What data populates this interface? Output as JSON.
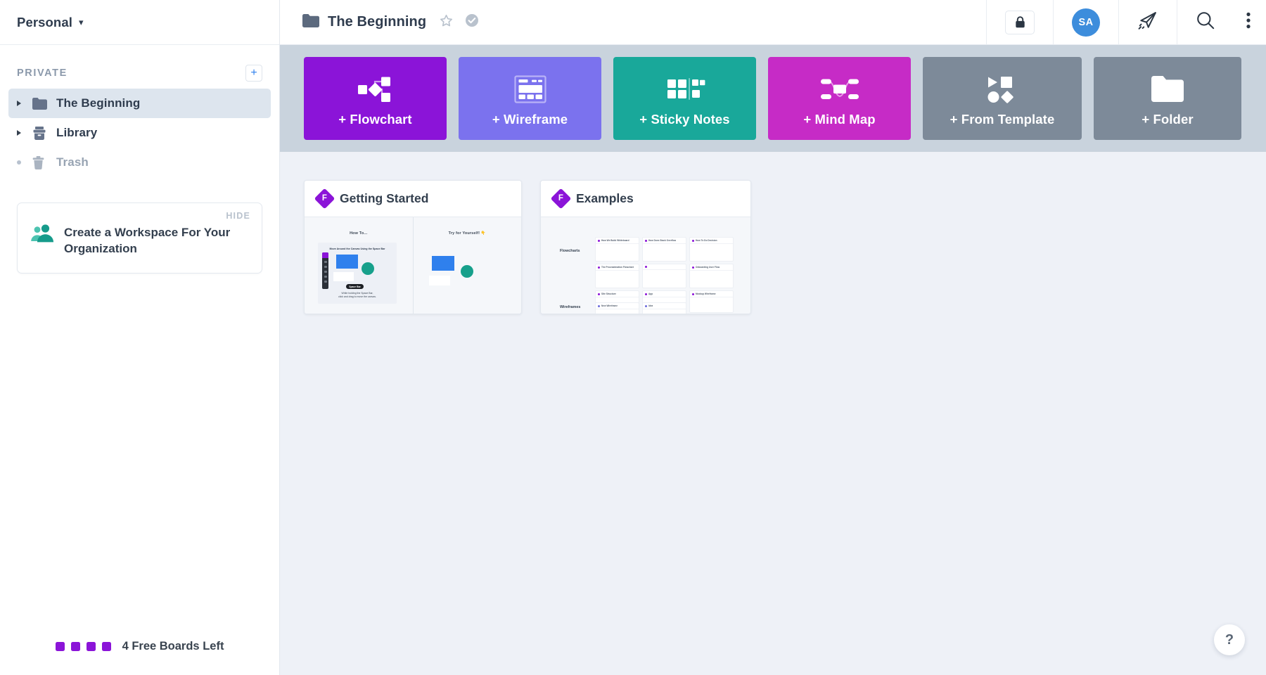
{
  "sidebar": {
    "workspace": {
      "name": "Personal",
      "caret_icon": "chevron-down-icon"
    },
    "section_title": "PRIVATE",
    "add_button_label": "+",
    "items": [
      {
        "label": "The Beginning",
        "icon": "folder-icon",
        "selected": true,
        "twisty": "triangle"
      },
      {
        "label": "Library",
        "icon": "library-icon",
        "selected": false,
        "twisty": "triangle"
      },
      {
        "label": "Trash",
        "icon": "trash-icon",
        "selected": false,
        "twisty": "dot"
      }
    ],
    "promo": {
      "hide_label": "HIDE",
      "title": "Create a Workspace For Your Organization",
      "icon": "people-icon"
    },
    "free_boards": {
      "count_squares": 4,
      "text": "4 Free Boards Left",
      "color": "#8b14d8"
    }
  },
  "header": {
    "folder_icon": "folder-icon",
    "title": "The Beginning",
    "star_icon": "star-outline-icon",
    "verified_icon": "check-circle-icon",
    "lock_icon": "lock-icon",
    "avatar_initials": "SA",
    "avatar_color": "#3d8ddc",
    "send_icon": "paper-plane-icon",
    "search_icon": "search-icon",
    "menu_icon": "kebab-menu-icon"
  },
  "actions": [
    {
      "label": "+ Flowchart",
      "color": "#8b14d8",
      "icon": "flowchart-icon"
    },
    {
      "label": "+ Wireframe",
      "color": "#7b72ee",
      "icon": "wireframe-icon"
    },
    {
      "label": "+ Sticky Notes",
      "color": "#19a89a",
      "icon": "sticky-notes-icon"
    },
    {
      "label": "+ Mind Map",
      "color": "#c62bc6",
      "icon": "mind-map-icon"
    },
    {
      "label": "+ From Template",
      "color": "#7d8a99",
      "icon": "shapes-icon"
    },
    {
      "label": "+ Folder",
      "color": "#7d8a99",
      "icon": "folder-icon"
    }
  ],
  "boards": [
    {
      "title": "Getting Started",
      "icon": "figjam-diamond-icon",
      "thumb": {
        "left_heading": "How To...",
        "right_heading": "Try for Yourself! 👇",
        "card_heading": "Move Around the Canvas Using the Space Bar",
        "pill_label": "Space Bar",
        "caption_line1": "While holding the Space Bar,",
        "caption_line2": "click and drag to move the canvas."
      }
    },
    {
      "title": "Examples",
      "icon": "figjam-diamond-icon",
      "thumb": {
        "sections": [
          "Flowcharts",
          "Wireframes"
        ],
        "tiles": [
          {
            "title": "How We Build Whiteboard",
            "row": 1,
            "col": 1
          },
          {
            "title": "How Does Stack Overflow",
            "row": 1,
            "col": 2
          },
          {
            "title": "How To Do Decision",
            "row": 1,
            "col": 3
          },
          {
            "title": "The Procrastination Flowchart",
            "row": 2,
            "col": 1
          },
          {
            "title": "",
            "row": 2,
            "col": 2
          },
          {
            "title": "Onboarding User Flow",
            "row": 2,
            "col": 3
          },
          {
            "title": "Site Structure",
            "row": 3,
            "col": 1
          },
          {
            "title": "App",
            "row": 3,
            "col": 2
          },
          {
            "title": "Mockup Wireframe",
            "row": 3,
            "col": 3
          },
          {
            "title": "New Wireframe",
            "row": 4,
            "col": 1
          },
          {
            "title": "Idea",
            "row": 4,
            "col": 2
          }
        ]
      }
    }
  ],
  "help": {
    "label": "?"
  }
}
